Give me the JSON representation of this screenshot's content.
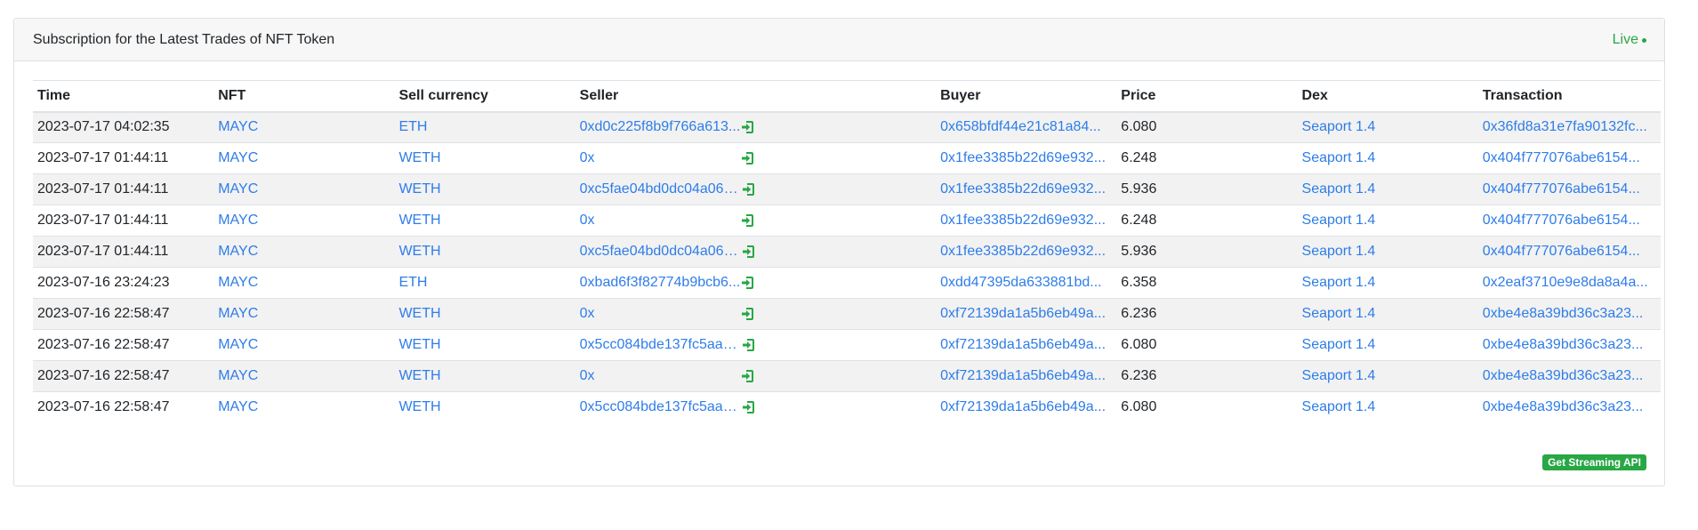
{
  "header": {
    "title": "Subscription for the Latest Trades of NFT Token",
    "live_label": "Live"
  },
  "table": {
    "columns": [
      "Time",
      "NFT",
      "Sell currency",
      "Seller",
      "Buyer",
      "Price",
      "Dex",
      "Transaction"
    ],
    "rows": [
      {
        "time": "2023-07-17 04:02:35",
        "nft": "MAYC",
        "currency": "ETH",
        "seller": "0xd0c225f8b9f766a613...",
        "buyer": "0x658bfdf44e21c81a84...",
        "price": "6.080",
        "dex": "Seaport 1.4",
        "tx": "0x36fd8a31e7fa90132fc..."
      },
      {
        "time": "2023-07-17 01:44:11",
        "nft": "MAYC",
        "currency": "WETH",
        "seller": "0x",
        "buyer": "0x1fee3385b22d69e932...",
        "price": "6.248",
        "dex": "Seaport 1.4",
        "tx": "0x404f777076abe6154..."
      },
      {
        "time": "2023-07-17 01:44:11",
        "nft": "MAYC",
        "currency": "WETH",
        "seller": "0xc5fae04bd0dc04a068...",
        "buyer": "0x1fee3385b22d69e932...",
        "price": "5.936",
        "dex": "Seaport 1.4",
        "tx": "0x404f777076abe6154..."
      },
      {
        "time": "2023-07-17 01:44:11",
        "nft": "MAYC",
        "currency": "WETH",
        "seller": "0x",
        "buyer": "0x1fee3385b22d69e932...",
        "price": "6.248",
        "dex": "Seaport 1.4",
        "tx": "0x404f777076abe6154..."
      },
      {
        "time": "2023-07-17 01:44:11",
        "nft": "MAYC",
        "currency": "WETH",
        "seller": "0xc5fae04bd0dc04a068...",
        "buyer": "0x1fee3385b22d69e932...",
        "price": "5.936",
        "dex": "Seaport 1.4",
        "tx": "0x404f777076abe6154..."
      },
      {
        "time": "2023-07-16 23:24:23",
        "nft": "MAYC",
        "currency": "ETH",
        "seller": "0xbad6f3f82774b9bcb6...",
        "buyer": "0xdd47395da633881bd...",
        "price": "6.358",
        "dex": "Seaport 1.4",
        "tx": "0x2eaf3710e9e8da8a4a..."
      },
      {
        "time": "2023-07-16 22:58:47",
        "nft": "MAYC",
        "currency": "WETH",
        "seller": "0x",
        "buyer": "0xf72139da1a5b6eb49a...",
        "price": "6.236",
        "dex": "Seaport 1.4",
        "tx": "0xbe4e8a39bd36c3a23..."
      },
      {
        "time": "2023-07-16 22:58:47",
        "nft": "MAYC",
        "currency": "WETH",
        "seller": "0x5cc084bde137fc5aae...",
        "buyer": "0xf72139da1a5b6eb49a...",
        "price": "6.080",
        "dex": "Seaport 1.4",
        "tx": "0xbe4e8a39bd36c3a23..."
      },
      {
        "time": "2023-07-16 22:58:47",
        "nft": "MAYC",
        "currency": "WETH",
        "seller": "0x",
        "buyer": "0xf72139da1a5b6eb49a...",
        "price": "6.236",
        "dex": "Seaport 1.4",
        "tx": "0xbe4e8a39bd36c3a23..."
      },
      {
        "time": "2023-07-16 22:58:47",
        "nft": "MAYC",
        "currency": "WETH",
        "seller": "0x5cc084bde137fc5aae...",
        "buyer": "0xf72139da1a5b6eb49a...",
        "price": "6.080",
        "dex": "Seaport 1.4",
        "tx": "0xbe4e8a39bd36c3a23..."
      }
    ]
  },
  "footer": {
    "api_button_label": "Get Streaming API"
  },
  "icons": {
    "seller_action": "sign-in-icon"
  },
  "colors": {
    "link": "#2e7de9",
    "live": "#28a745",
    "button_bg": "#28a745",
    "header_bg": "#f7f7f7",
    "stripe": "#f2f2f2"
  }
}
